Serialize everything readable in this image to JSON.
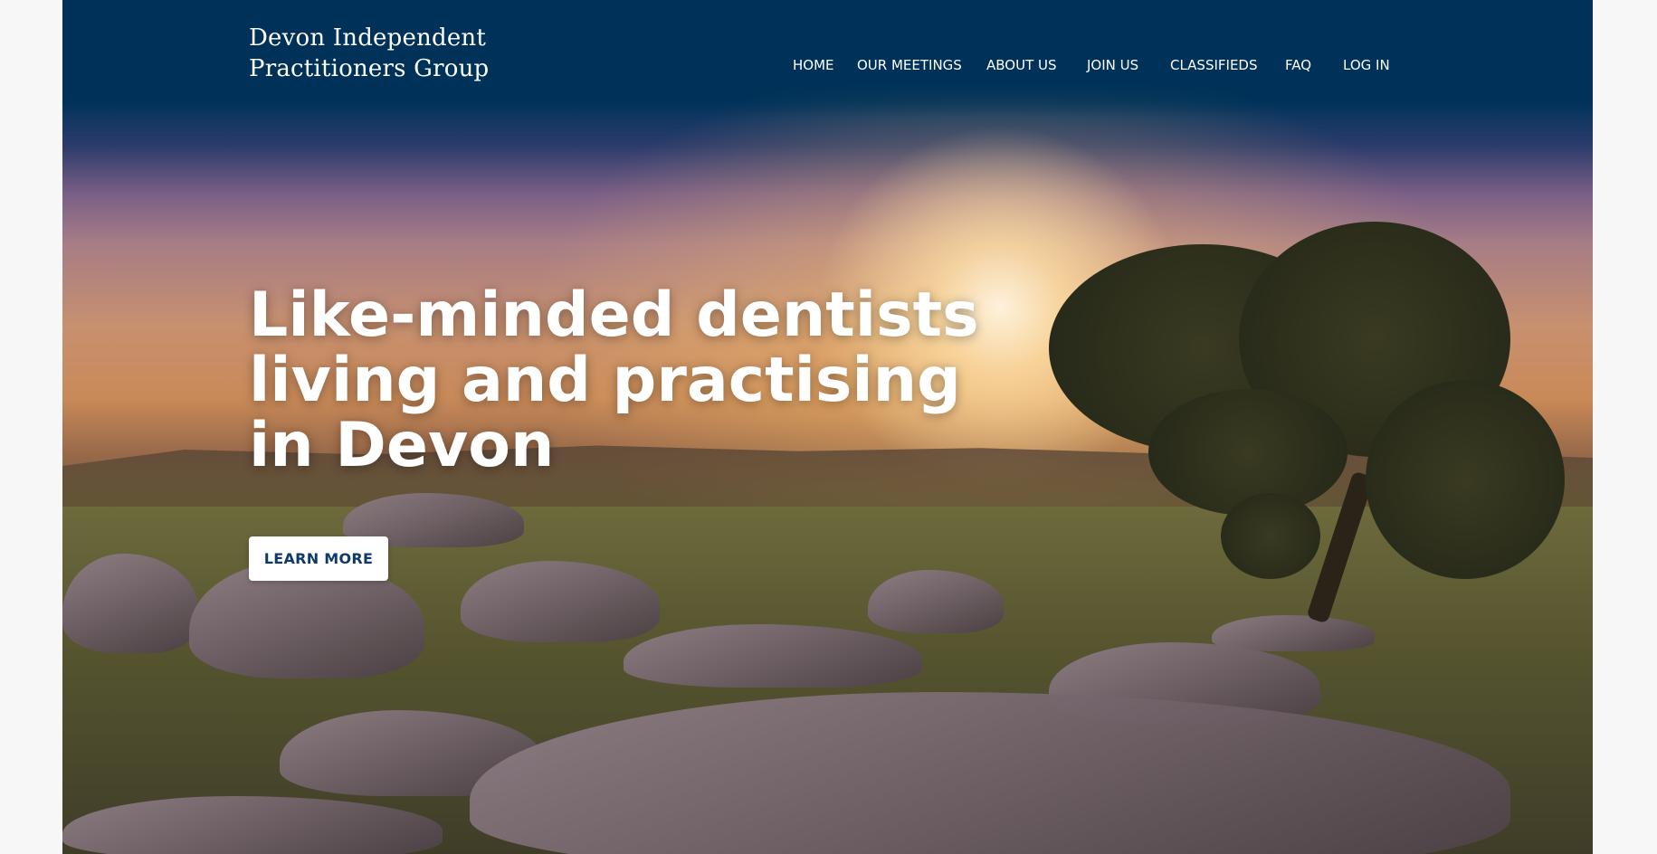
{
  "site": {
    "title_line1": "Devon Independent",
    "title_line2": "Practitioners Group"
  },
  "nav": {
    "items": [
      {
        "label": "HOME"
      },
      {
        "label": "OUR MEETINGS"
      },
      {
        "label": "ABOUT US"
      },
      {
        "label": "JOIN US"
      },
      {
        "label": "CLASSIFIEDS"
      },
      {
        "label": "FAQ"
      },
      {
        "label": "LOG IN"
      }
    ]
  },
  "hero": {
    "heading_line1": "Like-minded dentists",
    "heading_line2": "living and practising",
    "heading_line3": "in Devon",
    "cta_label": "LEARN MORE"
  },
  "colors": {
    "header_bg": "#003158",
    "cta_text": "#0d3a6a",
    "page_bg": "#f7f7f7"
  }
}
